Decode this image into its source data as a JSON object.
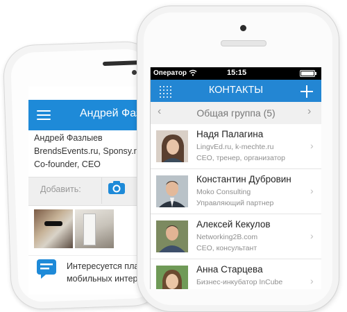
{
  "back_screen": {
    "header_title": "Андрей Фазлыев",
    "profile_lines": [
      "Андрей Фазлыев",
      "BrendsEvents.ru, Sponsy.ru",
      "Co-founder, CEO"
    ],
    "add_label": "Добавить:",
    "interest_lines": [
      "Интересуется пла",
      "мобильных интер"
    ],
    "accent_color": "#1e8ad8"
  },
  "front_screen": {
    "status": {
      "carrier": "Оператор",
      "time": "15:15"
    },
    "nav_title": "КОНТАКТЫ",
    "group": {
      "prev": "‹",
      "title": "Общая группа (5)",
      "next": "›"
    },
    "contacts": [
      {
        "name": "Надя Палагина",
        "company": "LingvEd.ru, k-mechte.ru",
        "role": "CEO, тренер, организатор"
      },
      {
        "name": "Константин Дубровин",
        "company": "Moko Consulting",
        "role": "Управляющий партнер"
      },
      {
        "name": "Алексей Кекулов",
        "company": "Networking2B.com",
        "role": "CEO, консультант"
      },
      {
        "name": "Анна Старцева",
        "company": "Бизнес-инкубатор InCube",
        "role": ""
      }
    ],
    "chevron": "›",
    "accent_color": "#2386d3"
  },
  "icons": [
    "menu-icon",
    "camera-icon",
    "chat-icon",
    "grid-icon",
    "plus-icon",
    "wifi-icon",
    "battery-icon",
    "chevron-right-icon"
  ]
}
